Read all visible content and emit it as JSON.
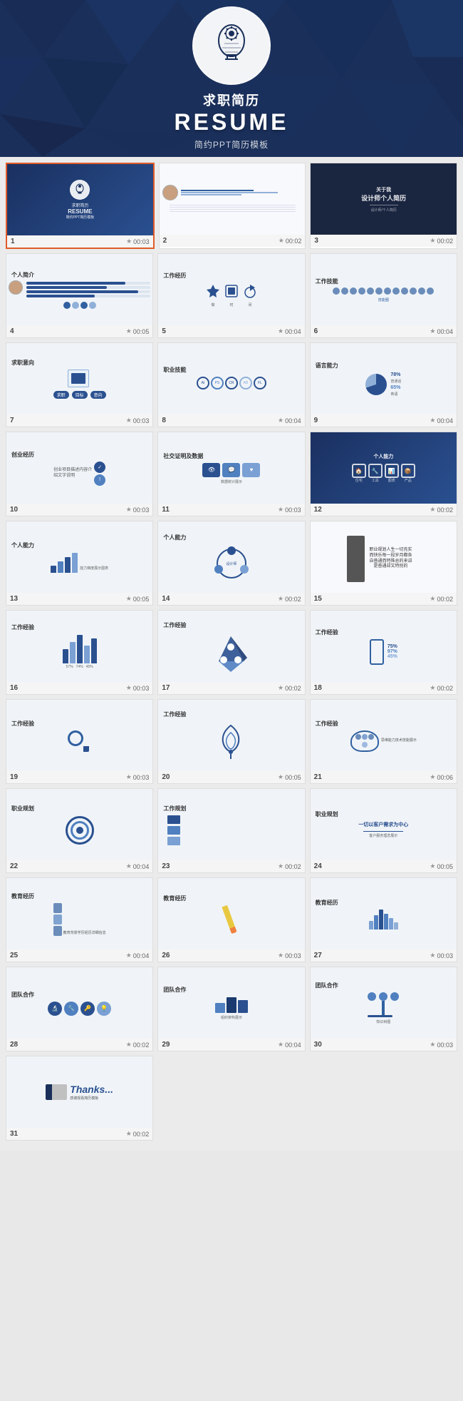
{
  "hero": {
    "title_cn": "求职简历",
    "title_en": "RESUME",
    "subtitle": "简约PPT简历模板",
    "icon_alt": "brain-gear-icon"
  },
  "slides": [
    {
      "id": 1,
      "num": "1",
      "time": "00:03",
      "type": "cover",
      "selected": true
    },
    {
      "id": 2,
      "num": "2",
      "time": "00:02",
      "type": "profile"
    },
    {
      "id": 3,
      "num": "3",
      "time": "00:02",
      "type": "about",
      "label": "关于我",
      "sublabel": "设计师个人简历"
    },
    {
      "id": 4,
      "num": "4",
      "time": "00:05",
      "type": "personal",
      "label": "个人简介"
    },
    {
      "id": 5,
      "num": "5",
      "time": "00:04",
      "type": "work",
      "label": "工作经历"
    },
    {
      "id": 6,
      "num": "6",
      "time": "00:04",
      "type": "workskill",
      "label": "工作技能"
    },
    {
      "id": 7,
      "num": "7",
      "time": "00:03",
      "type": "career",
      "label": "求职意向"
    },
    {
      "id": 8,
      "num": "8",
      "time": "00:04",
      "type": "skills2",
      "label": "职业技能"
    },
    {
      "id": 9,
      "num": "9",
      "time": "00:04",
      "type": "language",
      "label": "语言能力"
    },
    {
      "id": 10,
      "num": "10",
      "time": "00:03",
      "type": "project",
      "label": "创业经历"
    },
    {
      "id": 11,
      "num": "11",
      "time": "00:03",
      "type": "social",
      "label": "社交证明及数据"
    },
    {
      "id": 12,
      "num": "12",
      "time": "00:02",
      "type": "ability",
      "label": "个人能力"
    },
    {
      "id": 13,
      "num": "13",
      "time": "00:05",
      "type": "ability2",
      "label": "个人能力"
    },
    {
      "id": 14,
      "num": "14",
      "time": "00:02",
      "type": "ability3",
      "label": "个人能力"
    },
    {
      "id": 15,
      "num": "15",
      "time": "00:02",
      "type": "quote",
      "label": ""
    },
    {
      "id": 16,
      "num": "16",
      "time": "00:03",
      "type": "experience",
      "label": "工作经验"
    },
    {
      "id": 17,
      "num": "17",
      "time": "00:02",
      "type": "experience2",
      "label": "工作经验"
    },
    {
      "id": 18,
      "num": "18",
      "time": "00:02",
      "type": "experience3",
      "label": "工作经验"
    },
    {
      "id": 19,
      "num": "19",
      "time": "00:03",
      "type": "exp4",
      "label": "工作经验"
    },
    {
      "id": 20,
      "num": "20",
      "time": "00:05",
      "type": "exp5",
      "label": "工作经验"
    },
    {
      "id": 21,
      "num": "21",
      "time": "00:06",
      "type": "exp6",
      "label": "工作经验"
    },
    {
      "id": 22,
      "num": "22",
      "time": "00:04",
      "type": "target",
      "label": "职业规划"
    },
    {
      "id": 23,
      "num": "23",
      "time": "00:02",
      "type": "plan",
      "label": "工作规划"
    },
    {
      "id": 24,
      "num": "24",
      "time": "00:05",
      "type": "customer",
      "label": "职业规划"
    },
    {
      "id": 25,
      "num": "25",
      "time": "00:04",
      "type": "edu",
      "label": "教育经历"
    },
    {
      "id": 26,
      "num": "26",
      "time": "00:03",
      "type": "edu2",
      "label": "教育经历"
    },
    {
      "id": 27,
      "num": "27",
      "time": "00:03",
      "type": "edu3",
      "label": "教育经历"
    },
    {
      "id": 28,
      "num": "28",
      "time": "00:02",
      "type": "coop",
      "label": "团队合作"
    },
    {
      "id": 29,
      "num": "29",
      "time": "00:04",
      "type": "coop2",
      "label": "团队合作"
    },
    {
      "id": 30,
      "num": "30",
      "time": "00:03",
      "type": "coop3",
      "label": "团队合作"
    },
    {
      "id": 31,
      "num": "31",
      "time": "00:02",
      "type": "thanks",
      "label": "Thanks..."
    }
  ]
}
